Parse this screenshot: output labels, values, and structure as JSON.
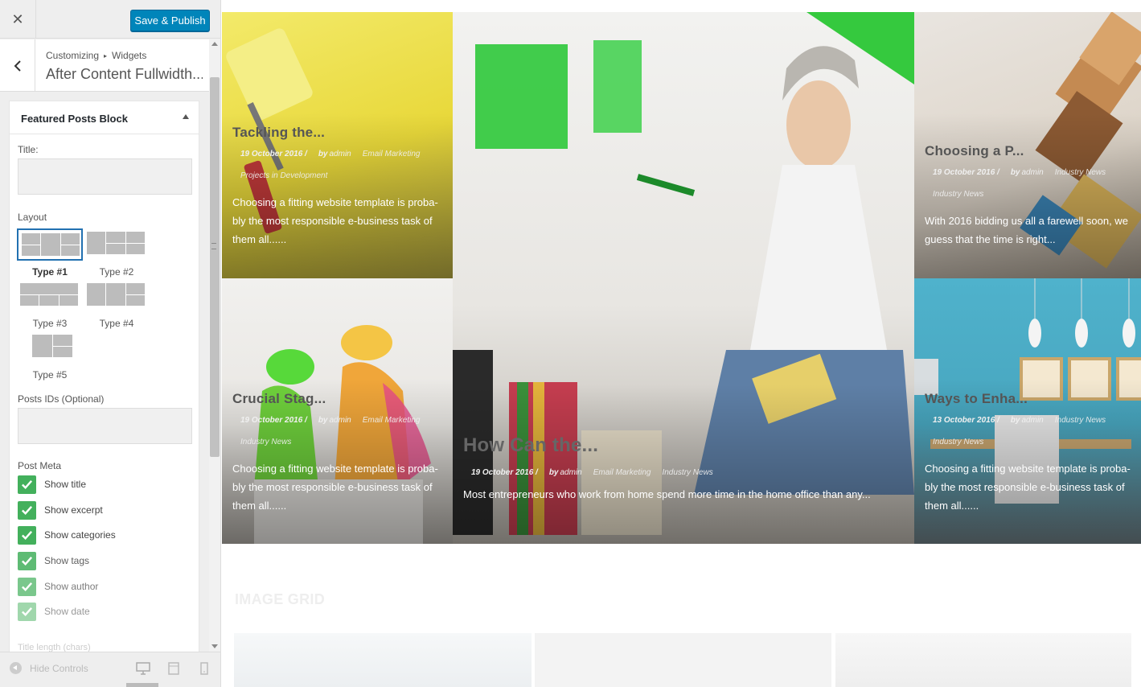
{
  "topbar": {
    "close_glyph": "✕",
    "publish_label": "Save & Publish"
  },
  "panel": {
    "crumb_1": "Customizing",
    "crumb_sep": "▸",
    "crumb_2": "Widgets",
    "title": "After Content Fullwidth..."
  },
  "widget": {
    "title": "Featured Posts Block",
    "title_label": "Title:",
    "title_value": "",
    "layout_label": "Layout",
    "layouts": [
      {
        "label": "Type #1",
        "selected": true
      },
      {
        "label": "Type #2",
        "selected": false
      },
      {
        "label": "Type #3",
        "selected": false
      },
      {
        "label": "Type #4",
        "selected": false
      },
      {
        "label": "Type #5",
        "selected": false
      }
    ],
    "post_ids_label": "Posts IDs (Optional)",
    "post_ids_value": "",
    "post_meta_label": "Post Meta",
    "meta_options": [
      {
        "label": "Show title",
        "checked": true
      },
      {
        "label": "Show excerpt",
        "checked": true
      },
      {
        "label": "Show categories",
        "checked": true
      },
      {
        "label": "Show tags",
        "checked": true
      },
      {
        "label": "Show author",
        "checked": true
      },
      {
        "label": "Show date",
        "checked": true
      }
    ],
    "title_length_label": "Title length (chars)"
  },
  "bottombar": {
    "hide_controls": "Hide Controls",
    "devices": [
      "desktop-icon",
      "tablet-icon",
      "mobile-icon"
    ]
  },
  "colors": {
    "accent": "#0085ba",
    "check": "#43b05c",
    "selected_border": "#2271b1"
  },
  "posts": [
    {
      "title": "Tackling the...",
      "date": "19 October 2016 /",
      "by": "by",
      "author": "admin",
      "categories": [
        "Email Marketing",
        "Projects in Development"
      ],
      "excerpt_1": "Choosing a fitting website template is proba-",
      "excerpt_2": "bly the most responsible e-business task of",
      "excerpt_3": "them all......"
    },
    {
      "title": "How Can the...",
      "date": "19 October 2016 /",
      "by": "by",
      "author": "admin",
      "categories": [
        "Email Marketing",
        "Industry News"
      ],
      "excerpt_1": "Most entrepreneurs who work from home spend more time in the home office than any...",
      "excerpt_2": "",
      "excerpt_3": ""
    },
    {
      "title": "Choosing a P...",
      "date": "19 October 2016 /",
      "by": "by",
      "author": "admin",
      "categories": [
        "Industry News",
        "Industry News"
      ],
      "excerpt_1": "With 2016 bidding us all a farewell soon, we",
      "excerpt_2": "guess that the time is right...",
      "excerpt_3": ""
    },
    {
      "title": "Crucial Stag...",
      "date": "19 October 2016 /",
      "by": "by",
      "author": "admin",
      "categories": [
        "Email Marketing",
        "Industry News"
      ],
      "excerpt_1": "Choosing a fitting website template is proba-",
      "excerpt_2": "bly the most responsible e-business task of",
      "excerpt_3": "them all......"
    },
    {
      "title": "Ways to Enha...",
      "date": "13 October 2016 /",
      "by": "by",
      "author": "admin",
      "categories": [
        "Industry News",
        "Industry News"
      ],
      "excerpt_1": "Choosing a fitting website template is proba-",
      "excerpt_2": "bly the most responsible e-business task of",
      "excerpt_3": "them all......"
    }
  ],
  "section_title": "IMAGE GRID"
}
